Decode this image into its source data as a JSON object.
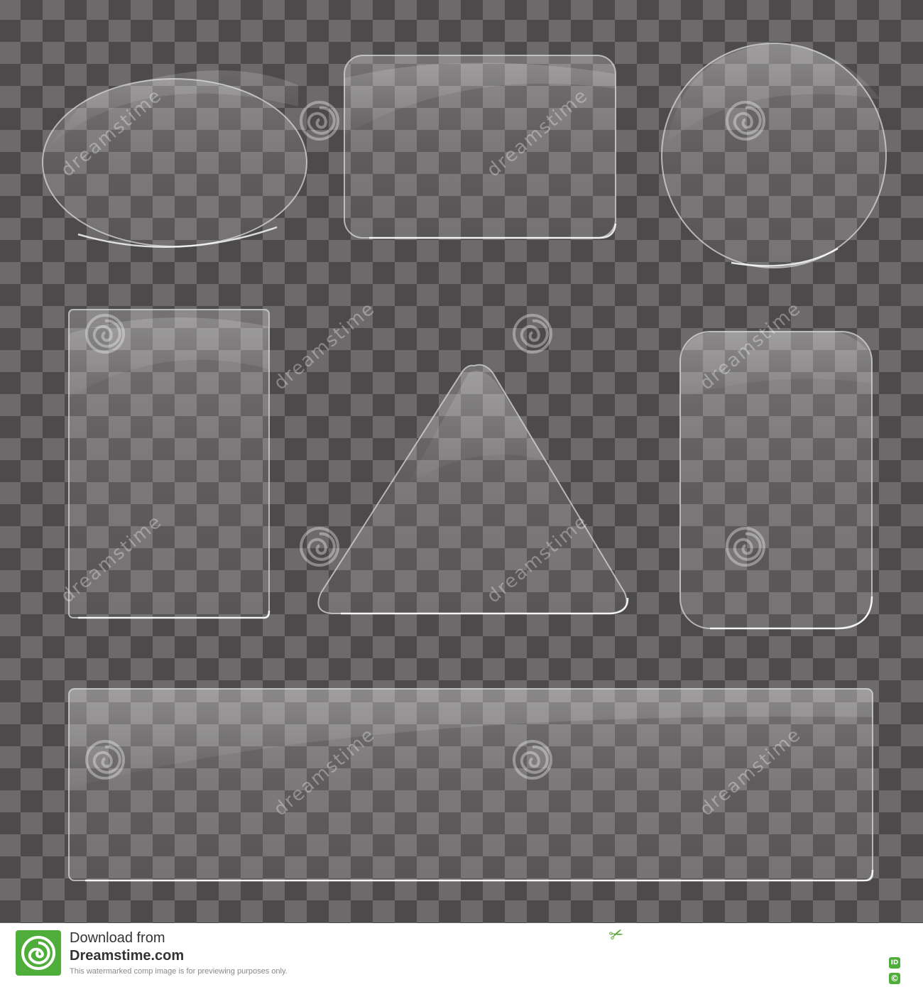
{
  "image": {
    "description_tag": "glass plates on transparent checkerboard",
    "background_colors": {
      "dark": "#4d4a4b",
      "light": "#6d6a6b"
    },
    "shapes": [
      {
        "name": "oval-glass-plate"
      },
      {
        "name": "rounded-rectangle-glass-plate"
      },
      {
        "name": "circle-glass-plate"
      },
      {
        "name": "vertical-rectangle-glass-plate"
      },
      {
        "name": "triangle-glass-plate"
      },
      {
        "name": "rounded-vertical-glass-plate"
      },
      {
        "name": "banner-glass-plate"
      }
    ],
    "watermark_text": "dreamstime"
  },
  "footer": {
    "line1": "Download from",
    "line2": "Dreamstime.com",
    "line3": "This watermarked comp image is for previewing purposes only.",
    "badge_id": "ID",
    "badge_copy": "©",
    "brand_color": "#4fae3a"
  }
}
